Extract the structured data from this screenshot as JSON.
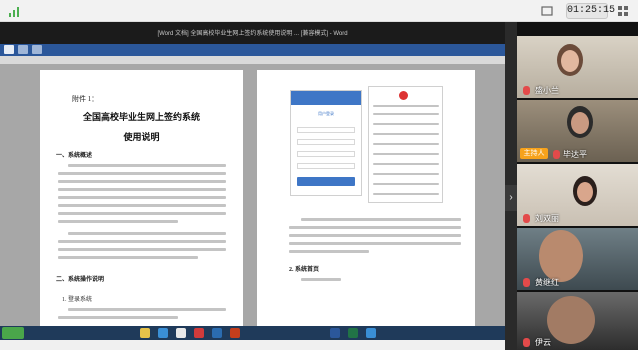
{
  "meeting": {
    "timer": "01:25:15",
    "icons": [
      "signal-icon",
      "window-icon",
      "grid-icon"
    ]
  },
  "word": {
    "window_title": "[Word 文档] 全国高校毕业生网上签约系统使用说明 ... [兼容模式] - Word",
    "page1": {
      "attachment": "附件 1：",
      "title_line1": "全国高校毕业生网上签约系统",
      "title_line2": "使用说明",
      "section1": "一、系统概述",
      "section2": "二、系统操作说明",
      "section2_1": "1. 登录系统"
    },
    "page2": {
      "login_title": "用户登录",
      "section": "2. 系统首页"
    }
  },
  "participants": [
    {
      "name": "盛小兰",
      "host": false
    },
    {
      "name": "毕达平",
      "host": true,
      "badge": "主持人"
    },
    {
      "name": "刘双丽",
      "host": false
    },
    {
      "name": "黄继红",
      "host": false
    },
    {
      "name": "伊云",
      "host": false
    }
  ],
  "colors": {
    "ribbon": "#2b579a",
    "host_badge": "#f7a21b",
    "mic_muted": "#e34a4a",
    "login_blue": "#3e76c6"
  }
}
